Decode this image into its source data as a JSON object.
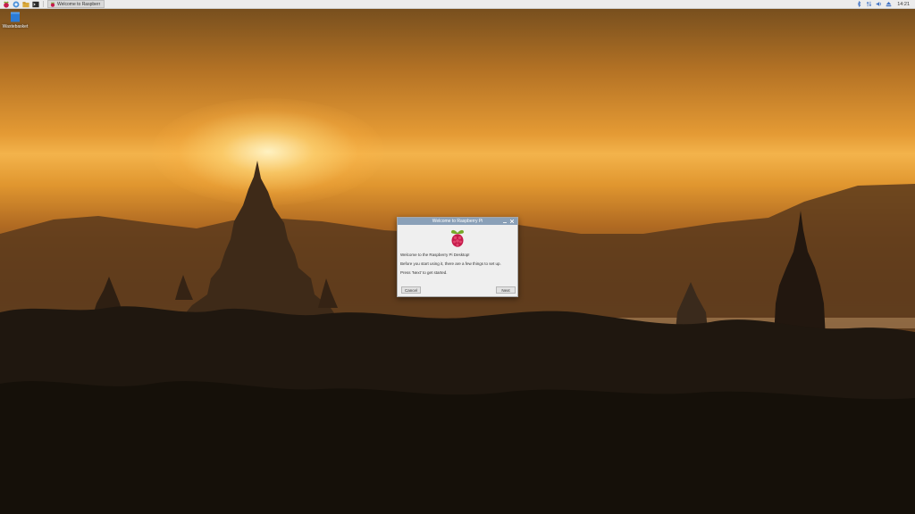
{
  "taskbar": {
    "launchers": [
      {
        "icon": "raspberry-menu-icon"
      },
      {
        "icon": "web-browser-icon"
      },
      {
        "icon": "file-manager-icon"
      },
      {
        "icon": "terminal-icon"
      }
    ],
    "window_button": {
      "icon": "raspberry-icon",
      "label": "Welcome to Raspberr"
    },
    "tray": [
      {
        "icon": "bluetooth-icon"
      },
      {
        "icon": "network-icon"
      },
      {
        "icon": "volume-icon"
      },
      {
        "icon": "eject-icon"
      }
    ],
    "clock": "14:21"
  },
  "desktop": {
    "icons": [
      {
        "icon": "wastebasket-icon",
        "label": "Wastebasket"
      }
    ],
    "wallpaper": "sunset-temples"
  },
  "dialog": {
    "title": "Welcome to Raspberry Pi",
    "logo_icon": "raspberry-pi-logo-icon",
    "line1": "Welcome to the Raspberry Pi Desktop!",
    "line2": "Before you start using it, there are a few things to set up.",
    "line3": "Press 'Next' to get started.",
    "cancel_label": "Cancel",
    "next_label": "Next"
  },
  "colors": {
    "panel": "#ececec",
    "dialog_title": "#8aa0b8",
    "raspberry_red": "#c51a4a",
    "leaf_green": "#75a928"
  }
}
